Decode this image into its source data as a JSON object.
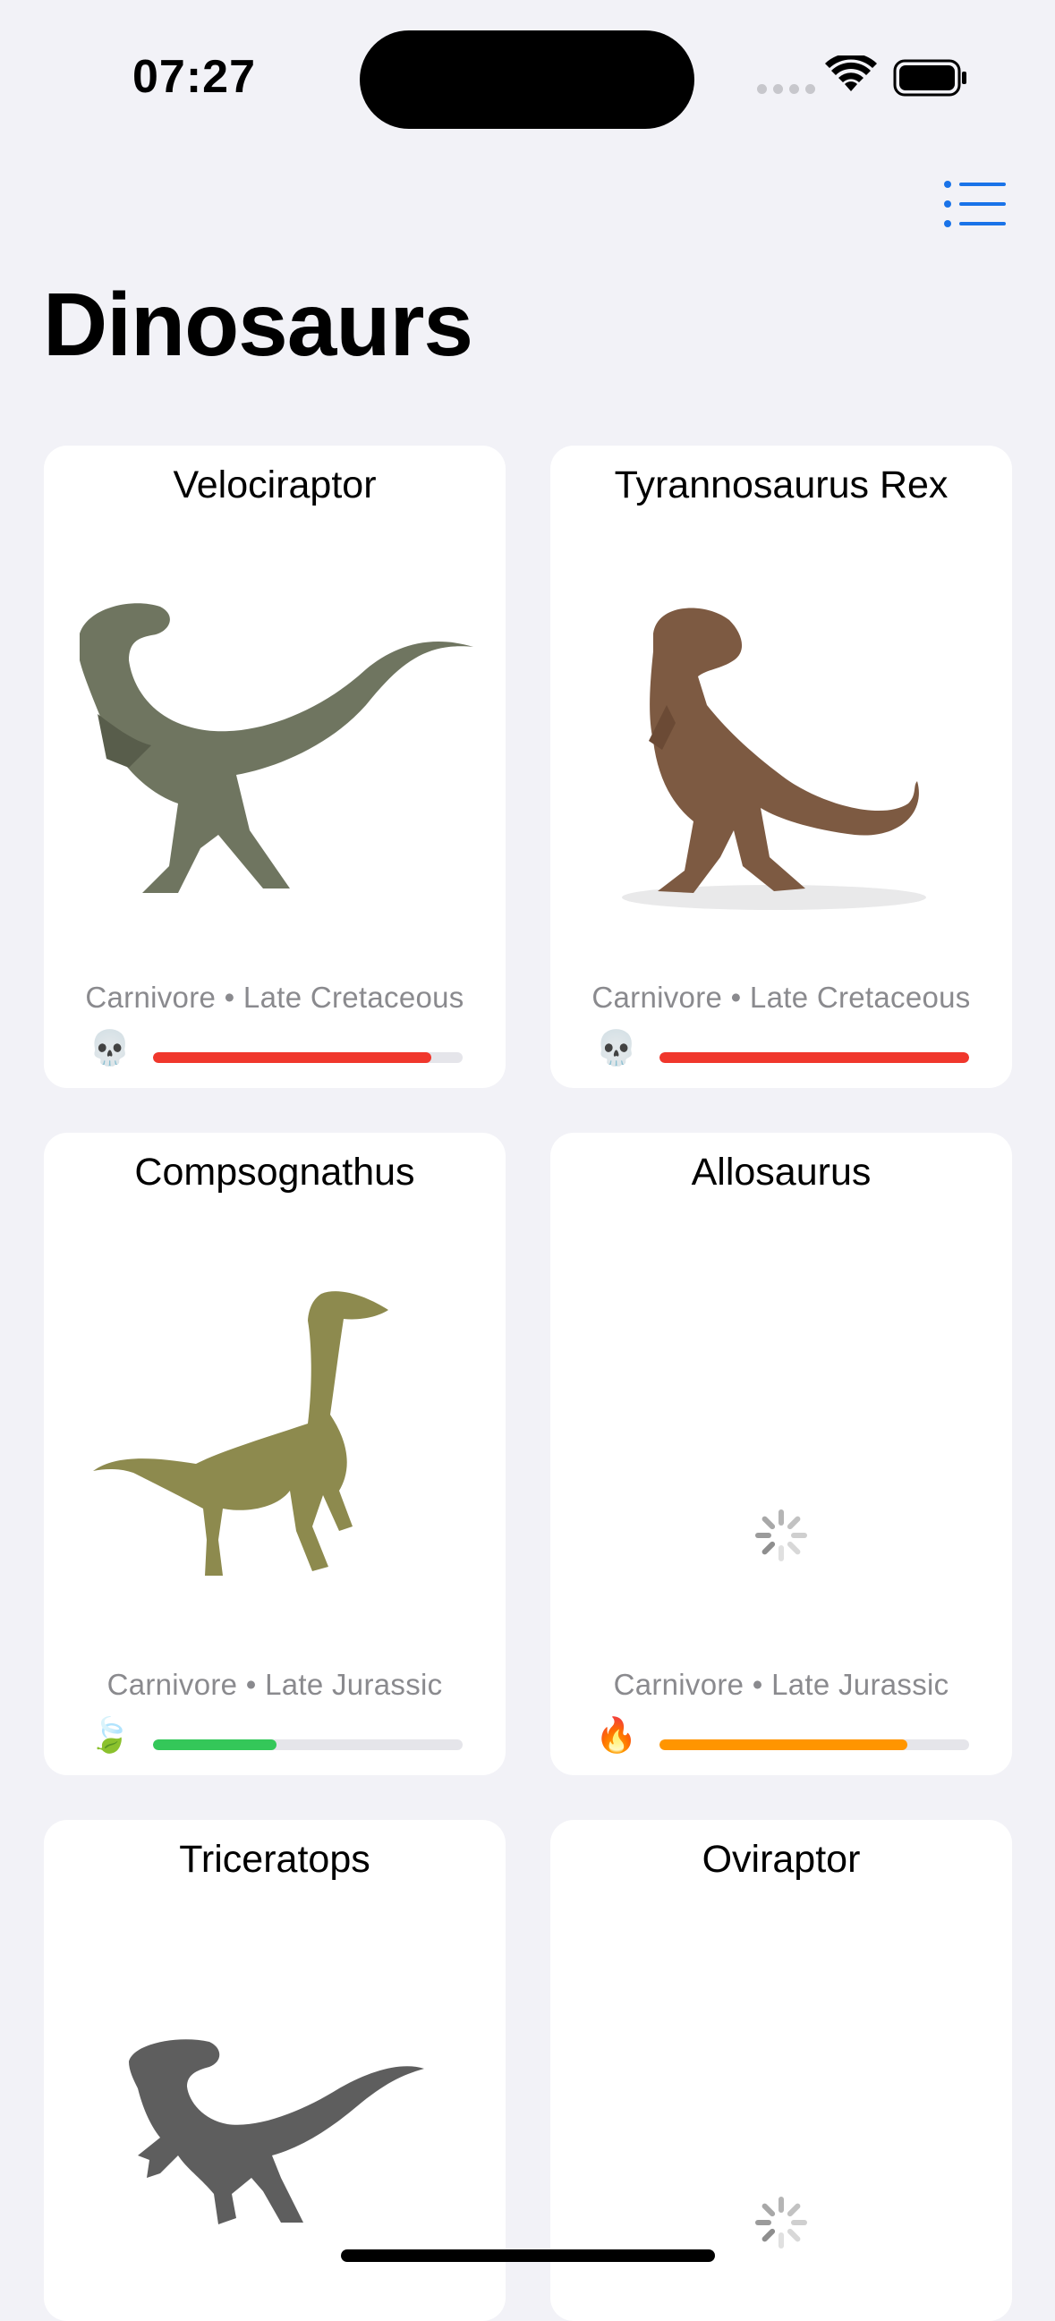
{
  "status_bar": {
    "time": "07:27",
    "icons": [
      "cellular-signal-icon",
      "wifi-icon",
      "battery-icon"
    ]
  },
  "header": {
    "title": "Dinosaurs",
    "view_toggle_icon": "list-icon"
  },
  "colors": {
    "accent": "#1a73e8",
    "danger_high": "#f0372c",
    "danger_low": "#34c759",
    "danger_mid": "#ff9500"
  },
  "cards": [
    {
      "name": "Velociraptor",
      "meta": "Carnivore • Late Cretaceous",
      "danger_icon": "💀",
      "danger_level": 0.9,
      "image": "velociraptor-image"
    },
    {
      "name": "Tyrannosaurus Rex",
      "meta": "Carnivore • Late Cretaceous",
      "danger_icon": "💀",
      "danger_level": 1.0,
      "image": "trex-image"
    },
    {
      "name": "Compsognathus",
      "meta": "Carnivore • Late Jurassic",
      "danger_icon": "🍃",
      "danger_level": 0.4,
      "image": "compsognathus-image"
    },
    {
      "name": "Allosaurus",
      "meta": "Carnivore • Late Jurassic",
      "danger_icon": "🔥",
      "danger_level": 0.8,
      "image": "loading-spinner"
    },
    {
      "name": "Triceratops",
      "meta": "",
      "image": "placeholder-silhouette"
    },
    {
      "name": "Oviraptor",
      "meta": "",
      "image": "loading-spinner"
    }
  ]
}
